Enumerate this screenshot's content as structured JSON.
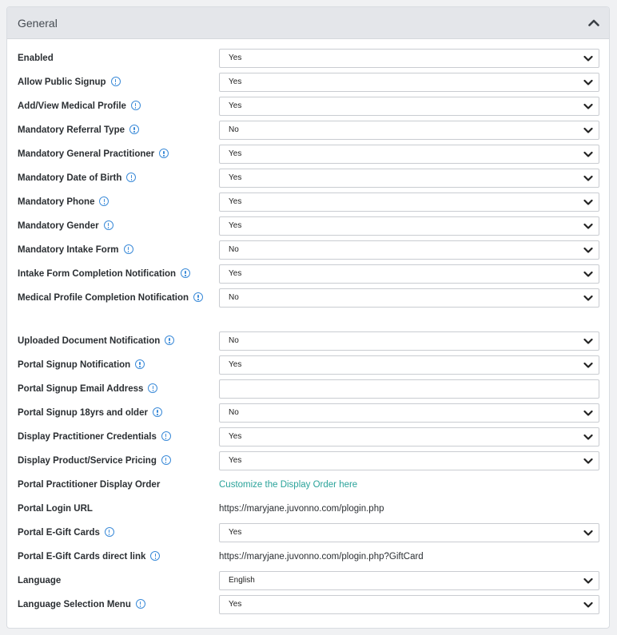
{
  "panel": {
    "title": "General",
    "collapse_icon": "chevron-up-icon"
  },
  "rows": [
    {
      "label": "Enabled",
      "info": false,
      "control": "select",
      "value": "Yes"
    },
    {
      "label": "Allow Public Signup",
      "info": true,
      "control": "select",
      "value": "Yes"
    },
    {
      "label": "Add/View Medical Profile",
      "info": true,
      "control": "select",
      "value": "Yes"
    },
    {
      "label": "Mandatory Referral Type",
      "info": true,
      "control": "select",
      "value": "No"
    },
    {
      "label": "Mandatory General Practitioner",
      "info": true,
      "control": "select",
      "value": "Yes"
    },
    {
      "label": "Mandatory Date of Birth",
      "info": true,
      "control": "select",
      "value": "Yes"
    },
    {
      "label": "Mandatory Phone",
      "info": true,
      "control": "select",
      "value": "Yes"
    },
    {
      "label": "Mandatory Gender",
      "info": true,
      "control": "select",
      "value": "Yes"
    },
    {
      "label": "Mandatory Intake Form",
      "info": true,
      "control": "select",
      "value": "No"
    },
    {
      "label": "Intake Form Completion Notification",
      "info": true,
      "control": "select",
      "value": "Yes"
    },
    {
      "label": "Medical Profile Completion Notification",
      "info": true,
      "control": "select",
      "value": "No"
    },
    {
      "label": "Uploaded Document Notification",
      "info": true,
      "control": "select",
      "value": "No"
    },
    {
      "label": "Portal Signup Notification",
      "info": true,
      "control": "select",
      "value": "Yes"
    },
    {
      "label": "Portal Signup Email Address",
      "info": true,
      "control": "input",
      "value": ""
    },
    {
      "label": "Portal Signup 18yrs and older",
      "info": true,
      "control": "select",
      "value": "No"
    },
    {
      "label": "Display Practitioner Credentials",
      "info": true,
      "control": "select",
      "value": "Yes"
    },
    {
      "label": "Display Product/Service Pricing",
      "info": true,
      "control": "select",
      "value": "Yes"
    },
    {
      "label": "Portal Practitioner Display Order",
      "info": false,
      "control": "link",
      "value": "Customize the Display Order here"
    },
    {
      "label": "Portal Login URL",
      "info": false,
      "control": "text",
      "value": "https://maryjane.juvonno.com/plogin.php"
    },
    {
      "label": "Portal E-Gift Cards",
      "info": true,
      "control": "select",
      "value": "Yes"
    },
    {
      "label": "Portal E-Gift Cards direct link",
      "info": true,
      "control": "text",
      "value": "https://maryjane.juvonno.com/plogin.php?GiftCard"
    },
    {
      "label": "Language",
      "info": false,
      "control": "select",
      "value": "English"
    },
    {
      "label": "Language Selection Menu",
      "info": true,
      "control": "select",
      "value": "Yes"
    }
  ]
}
